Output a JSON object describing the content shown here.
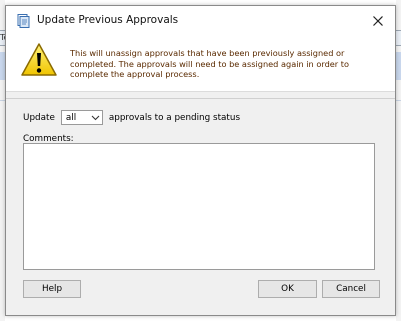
{
  "background": {
    "tab_label": "Te"
  },
  "dialog": {
    "title": "Update Previous Approvals",
    "warning_text": "This will unassign approvals that have been previously assigned or completed. The approvals will need to be assigned again in order to complete the approval process.",
    "update_label": "Update",
    "update_select_value": "all",
    "update_suffix": "approvals to a pending status",
    "comments_label": "Comments:",
    "comments_value": "",
    "buttons": {
      "help": "Help",
      "ok": "OK",
      "cancel": "Cancel"
    }
  },
  "icons": {
    "title": "approvals-icon",
    "close": "close-icon",
    "warning": "warning-icon",
    "select_arrow": "chevron-down-icon"
  }
}
